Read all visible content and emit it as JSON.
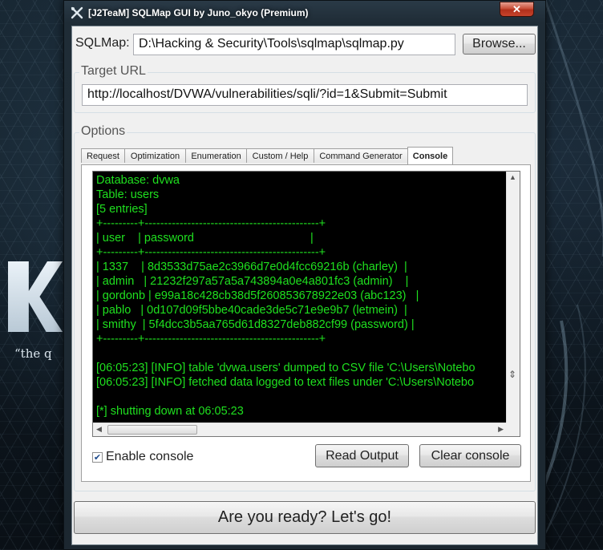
{
  "window": {
    "title": "[J2TeaM] SQLMap GUI by Juno_okyo (Premium)"
  },
  "background": {
    "quote": "“the q"
  },
  "sqlmap": {
    "label": "SQLMap:",
    "path": "D:\\Hacking & Security\\Tools\\sqlmap\\sqlmap.py",
    "browse_label": "Browse..."
  },
  "target": {
    "legend": "Target URL",
    "url": "http://localhost/DVWA/vulnerabilities/sqli/?id=1&Submit=Submit"
  },
  "options": {
    "legend": "Options",
    "tabs": [
      {
        "label": "Request"
      },
      {
        "label": "Optimization"
      },
      {
        "label": "Enumeration"
      },
      {
        "label": "Custom / Help"
      },
      {
        "label": "Command Generator"
      },
      {
        "label": "Console"
      }
    ],
    "active_tab": "Console"
  },
  "console": {
    "lines": [
      "Database: dvwa",
      "Table: users",
      "[5 entries]",
      "+---------+---------------------------------------------+",
      "| user    | password                                    |",
      "+---------+---------------------------------------------+",
      "| 1337    | 8d3533d75ae2c3966d7e0d4fcc69216b (charley)  |",
      "| admin   | 21232f297a57a5a743894a0e4a801fc3 (admin)    |",
      "| gordonb | e99a18c428cb38d5f260853678922e03 (abc123)   |",
      "| pablo   | 0d107d09f5bbe40cade3de5c71e9e9b7 (letmein)  |",
      "| smithy  | 5f4dcc3b5aa765d61d8327deb882cf99 (password) |",
      "+---------+---------------------------------------------+",
      "",
      "[06:05:23] [INFO] table 'dvwa.users' dumped to CSV file 'C:\\Users\\Notebo",
      "[06:05:23] [INFO] fetched data logged to text files under 'C:\\Users\\Notebo",
      "",
      "[*] shutting down at 06:05:23"
    ],
    "enable_label": "Enable console",
    "enabled": true,
    "read_output_label": "Read Output",
    "clear_label": "Clear console"
  },
  "go_label": "Are you ready? Let's go!",
  "colors": {
    "console_bg": "#000000",
    "console_text": "#1fe01f",
    "close_button": "#c7442c"
  }
}
